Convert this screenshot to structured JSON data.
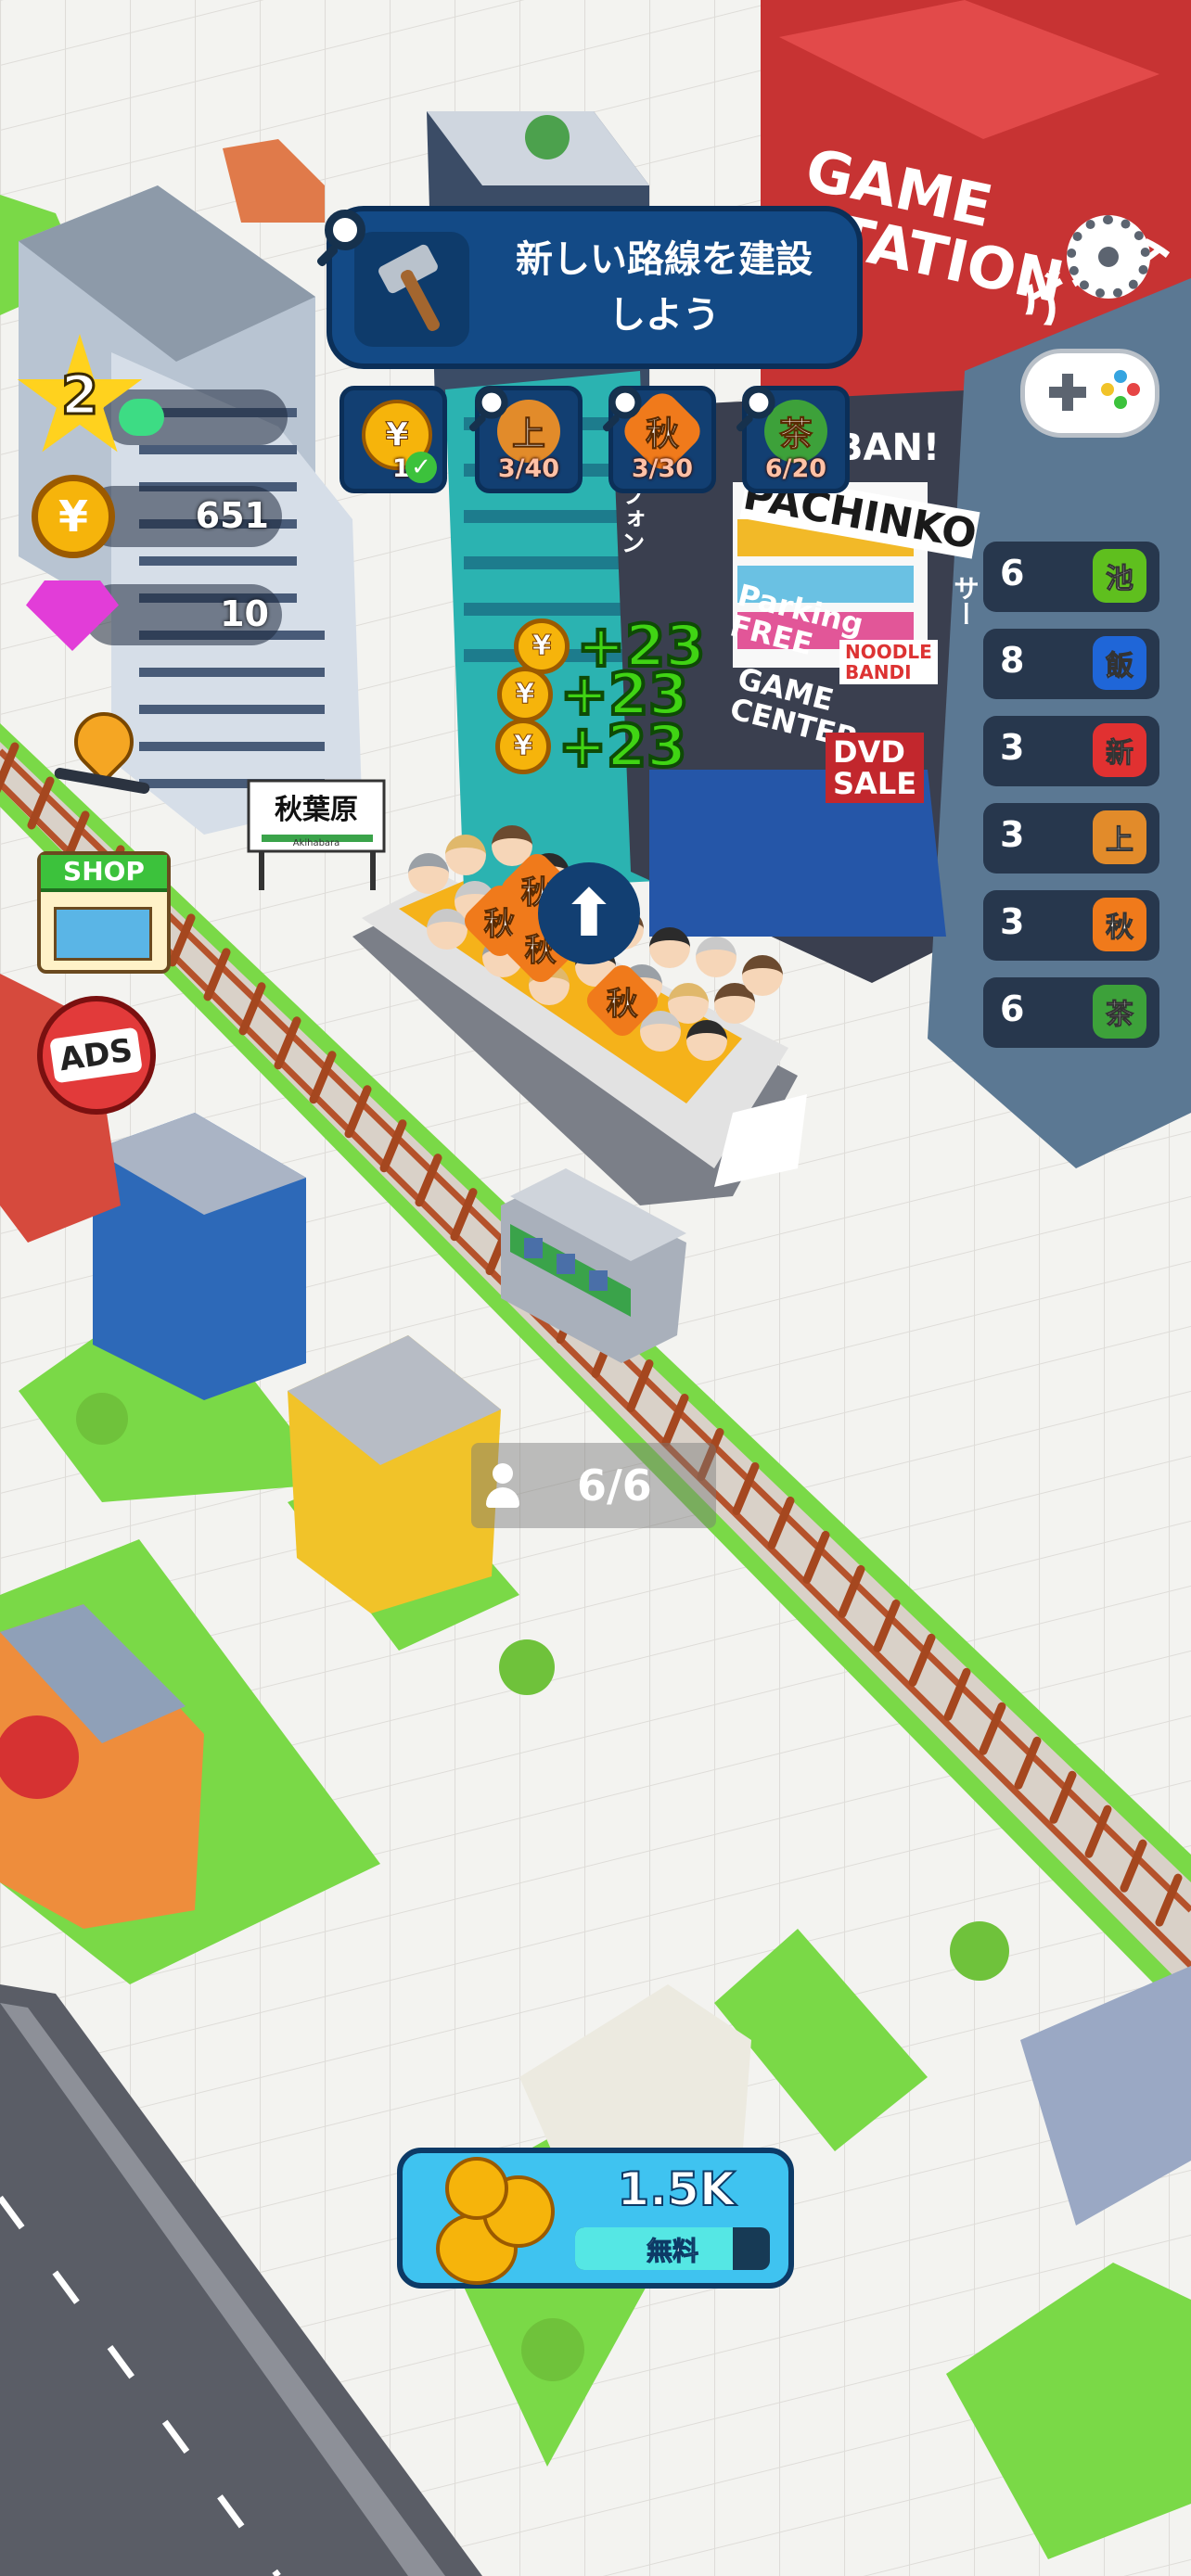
{
  "quest": {
    "title": "新しい路線を建設\nしよう",
    "icon": "hammer-icon"
  },
  "quest_chips": [
    {
      "symbol": "¥",
      "count": "1",
      "completed": true,
      "icon": "yen-coin-icon"
    },
    {
      "symbol": "上",
      "count": "3/40",
      "icon": "burger-ue-icon"
    },
    {
      "symbol": "秋",
      "count": "3/30",
      "icon": "maple-aki-icon"
    },
    {
      "symbol": "茶",
      "count": "6/20",
      "icon": "tea-leaf-icon"
    }
  ],
  "player": {
    "level": "2",
    "level_progress": 0.3,
    "coins": "651",
    "gems": "10"
  },
  "income_popups": [
    "+23",
    "+23",
    "+23"
  ],
  "station": {
    "name": "秋葉原",
    "sub": "Akihabara"
  },
  "passenger_bubbles": [
    "秋",
    "秋",
    "秋",
    "秋"
  ],
  "train": {
    "capacity": "6/6"
  },
  "side_list": [
    {
      "count": "6",
      "badge": "池",
      "color": "#5fbf1e",
      "icon": "pond-icon"
    },
    {
      "count": "8",
      "badge": "飯",
      "color": "#1f66d8",
      "icon": "rice-shield-icon"
    },
    {
      "count": "3",
      "badge": "新",
      "color": "#e13131",
      "icon": "cross-shin-icon"
    },
    {
      "count": "3",
      "badge": "上",
      "color": "#e28b2a",
      "icon": "burger-ue-icon"
    },
    {
      "count": "3",
      "badge": "秋",
      "color": "#f07a1b",
      "icon": "maple-aki-icon"
    },
    {
      "count": "6",
      "badge": "茶",
      "color": "#3da13a",
      "icon": "tea-leaf-icon"
    }
  ],
  "buttons": {
    "shop": "SHOP",
    "ads": "ADS",
    "reward_amount": "1.5K",
    "reward_label": "無料"
  },
  "billboards": {
    "game_station": "GAME\nSTATION",
    "game_station_jp": "ゲーム",
    "pachinko": "PACHINKO",
    "banner": "BAN!",
    "parking": "Parking\nFREE",
    "game_center": "GAME\nCENTER",
    "noodle": "NOODLE\nBANDI",
    "dvd": "DVD\nSALE",
    "fon": "フォン",
    "side_sign": "サー"
  },
  "colors": {
    "hud_navy": "#134a86",
    "hud_dark": "#0b2f58",
    "grass": "#7ad947",
    "track": "#d7cfc7",
    "reward_blue": "#3fc3f0"
  }
}
